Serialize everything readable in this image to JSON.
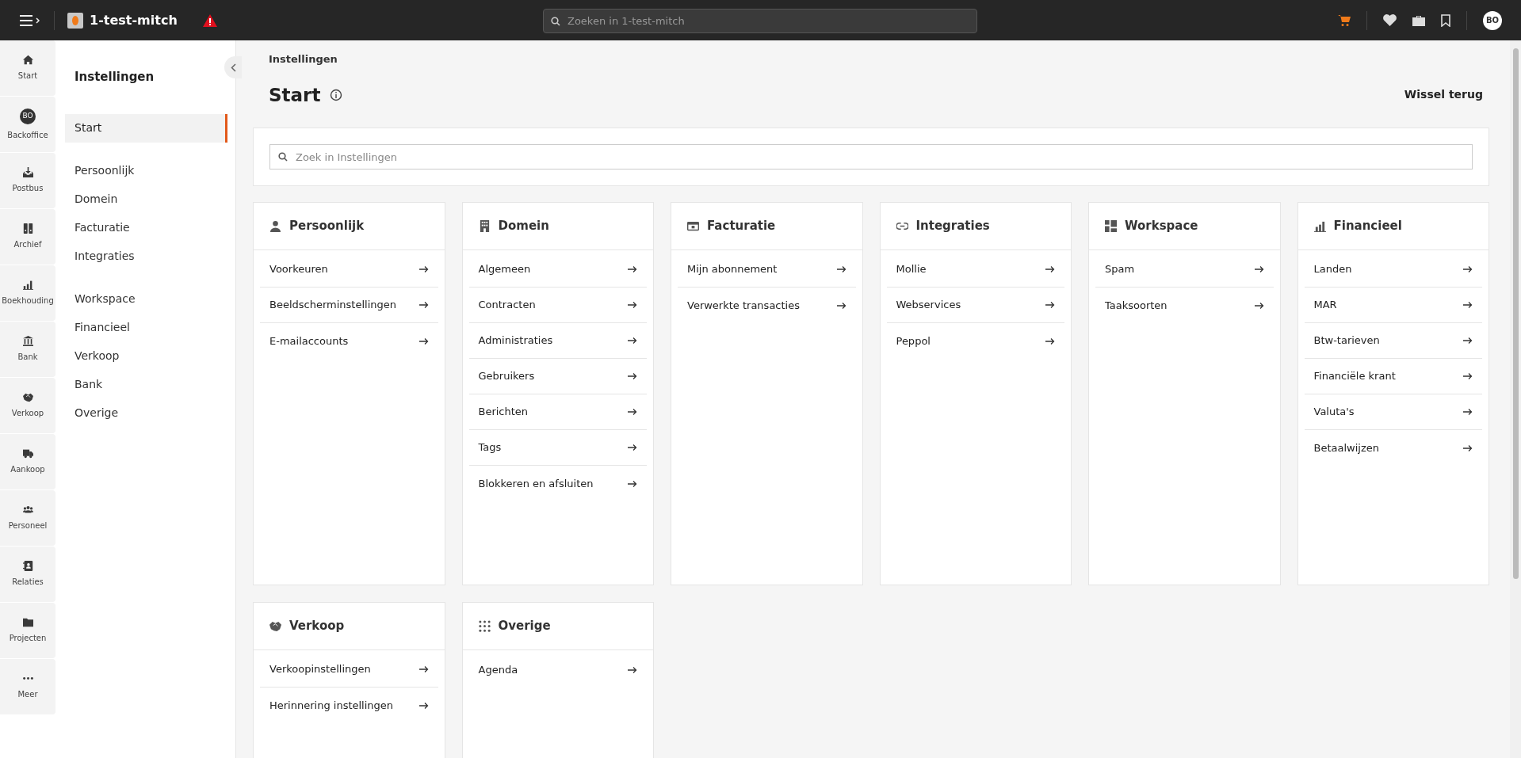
{
  "topbar": {
    "org_name": "1-test-mitch",
    "search": {
      "placeholder": "Zoeken in 1-test-mitch"
    },
    "avatar": "BO"
  },
  "rail": [
    {
      "label": "Start"
    },
    {
      "label": "Backoffice",
      "badge": "BO"
    },
    {
      "label": "Postbus"
    },
    {
      "label": "Archief"
    },
    {
      "label": "Boekhouding"
    },
    {
      "label": "Bank"
    },
    {
      "label": "Verkoop"
    },
    {
      "label": "Aankoop"
    },
    {
      "label": "Personeel"
    },
    {
      "label": "Relaties"
    },
    {
      "label": "Projecten"
    },
    {
      "label": "Meer"
    }
  ],
  "sidebar": {
    "title": "Instellingen",
    "groups": [
      [
        {
          "label": "Start",
          "selected": true
        }
      ],
      [
        {
          "label": "Persoonlijk",
          "selected": false
        },
        {
          "label": "Domein",
          "selected": false
        },
        {
          "label": "Facturatie",
          "selected": false
        },
        {
          "label": "Integraties",
          "selected": false
        }
      ],
      [
        {
          "label": "Workspace",
          "selected": false
        },
        {
          "label": "Financieel",
          "selected": false
        },
        {
          "label": "Verkoop",
          "selected": false
        },
        {
          "label": "Bank",
          "selected": false
        },
        {
          "label": "Overige",
          "selected": false
        }
      ]
    ]
  },
  "breadcrumb": "Instellingen",
  "page_title": "Start",
  "switch_back": "Wissel terug",
  "settings_search": {
    "placeholder": "Zoek in Instellingen"
  },
  "cards": [
    {
      "title": "Persoonlijk",
      "links": [
        "Voorkeuren",
        "Beeldscherminstellingen",
        "E-mailaccounts"
      ]
    },
    {
      "title": "Domein",
      "links": [
        "Algemeen",
        "Contracten",
        "Administraties",
        "Gebruikers",
        "Berichten",
        "Tags",
        "Blokkeren en afsluiten"
      ]
    },
    {
      "title": "Facturatie",
      "links": [
        "Mijn abonnement",
        "Verwerkte transacties"
      ]
    },
    {
      "title": "Integraties",
      "links": [
        "Mollie",
        "Webservices",
        "Peppol"
      ]
    },
    {
      "title": "Workspace",
      "links": [
        "Spam",
        "Taaksoorten"
      ]
    },
    {
      "title": "Financieel",
      "links": [
        "Landen",
        "MAR",
        "Btw-tarieven",
        "Financiële krant",
        "Valuta's",
        "Betaalwijzen"
      ]
    },
    {
      "title": "Verkoop",
      "links": [
        "Verkoopinstellingen",
        "Herinnering instellingen"
      ]
    },
    {
      "title": "Overige",
      "links": [
        "Agenda"
      ]
    }
  ]
}
